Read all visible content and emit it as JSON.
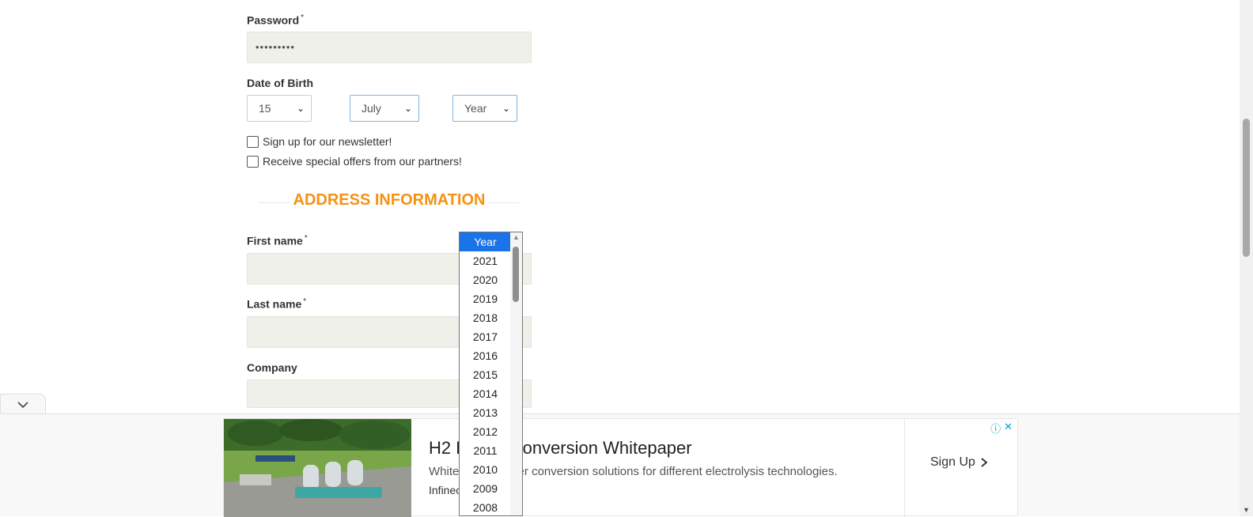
{
  "form": {
    "password_label": "Password",
    "password_value": "•••••••••",
    "required_mark": "*",
    "dob_label": "Date of Birth",
    "day_value": "15",
    "month_value": "July",
    "year_value": "Year",
    "newsletter_label": "Sign up for our newsletter!",
    "offers_label": "Receive special offers from our partners!",
    "address_title": "ADDRESS INFORMATION",
    "first_name_label": "First name",
    "last_name_label": "Last name",
    "company_label": "Company"
  },
  "year_dropdown": {
    "options": [
      "Year",
      "2021",
      "2020",
      "2019",
      "2018",
      "2017",
      "2016",
      "2015",
      "2014",
      "2013",
      "2012",
      "2011",
      "2010",
      "2009",
      "2008"
    ],
    "selected": "Year"
  },
  "ad": {
    "headline": "H2 Power Conversion Whitepaper",
    "description": "Whitepaper: power conversion solutions for different electrolysis technologies.",
    "brand": "Infineon",
    "cta": "Sign Up"
  },
  "colors": {
    "accent_orange": "#f39214",
    "select_highlight": "#1a73e8",
    "input_bg": "#f0f0ea"
  }
}
